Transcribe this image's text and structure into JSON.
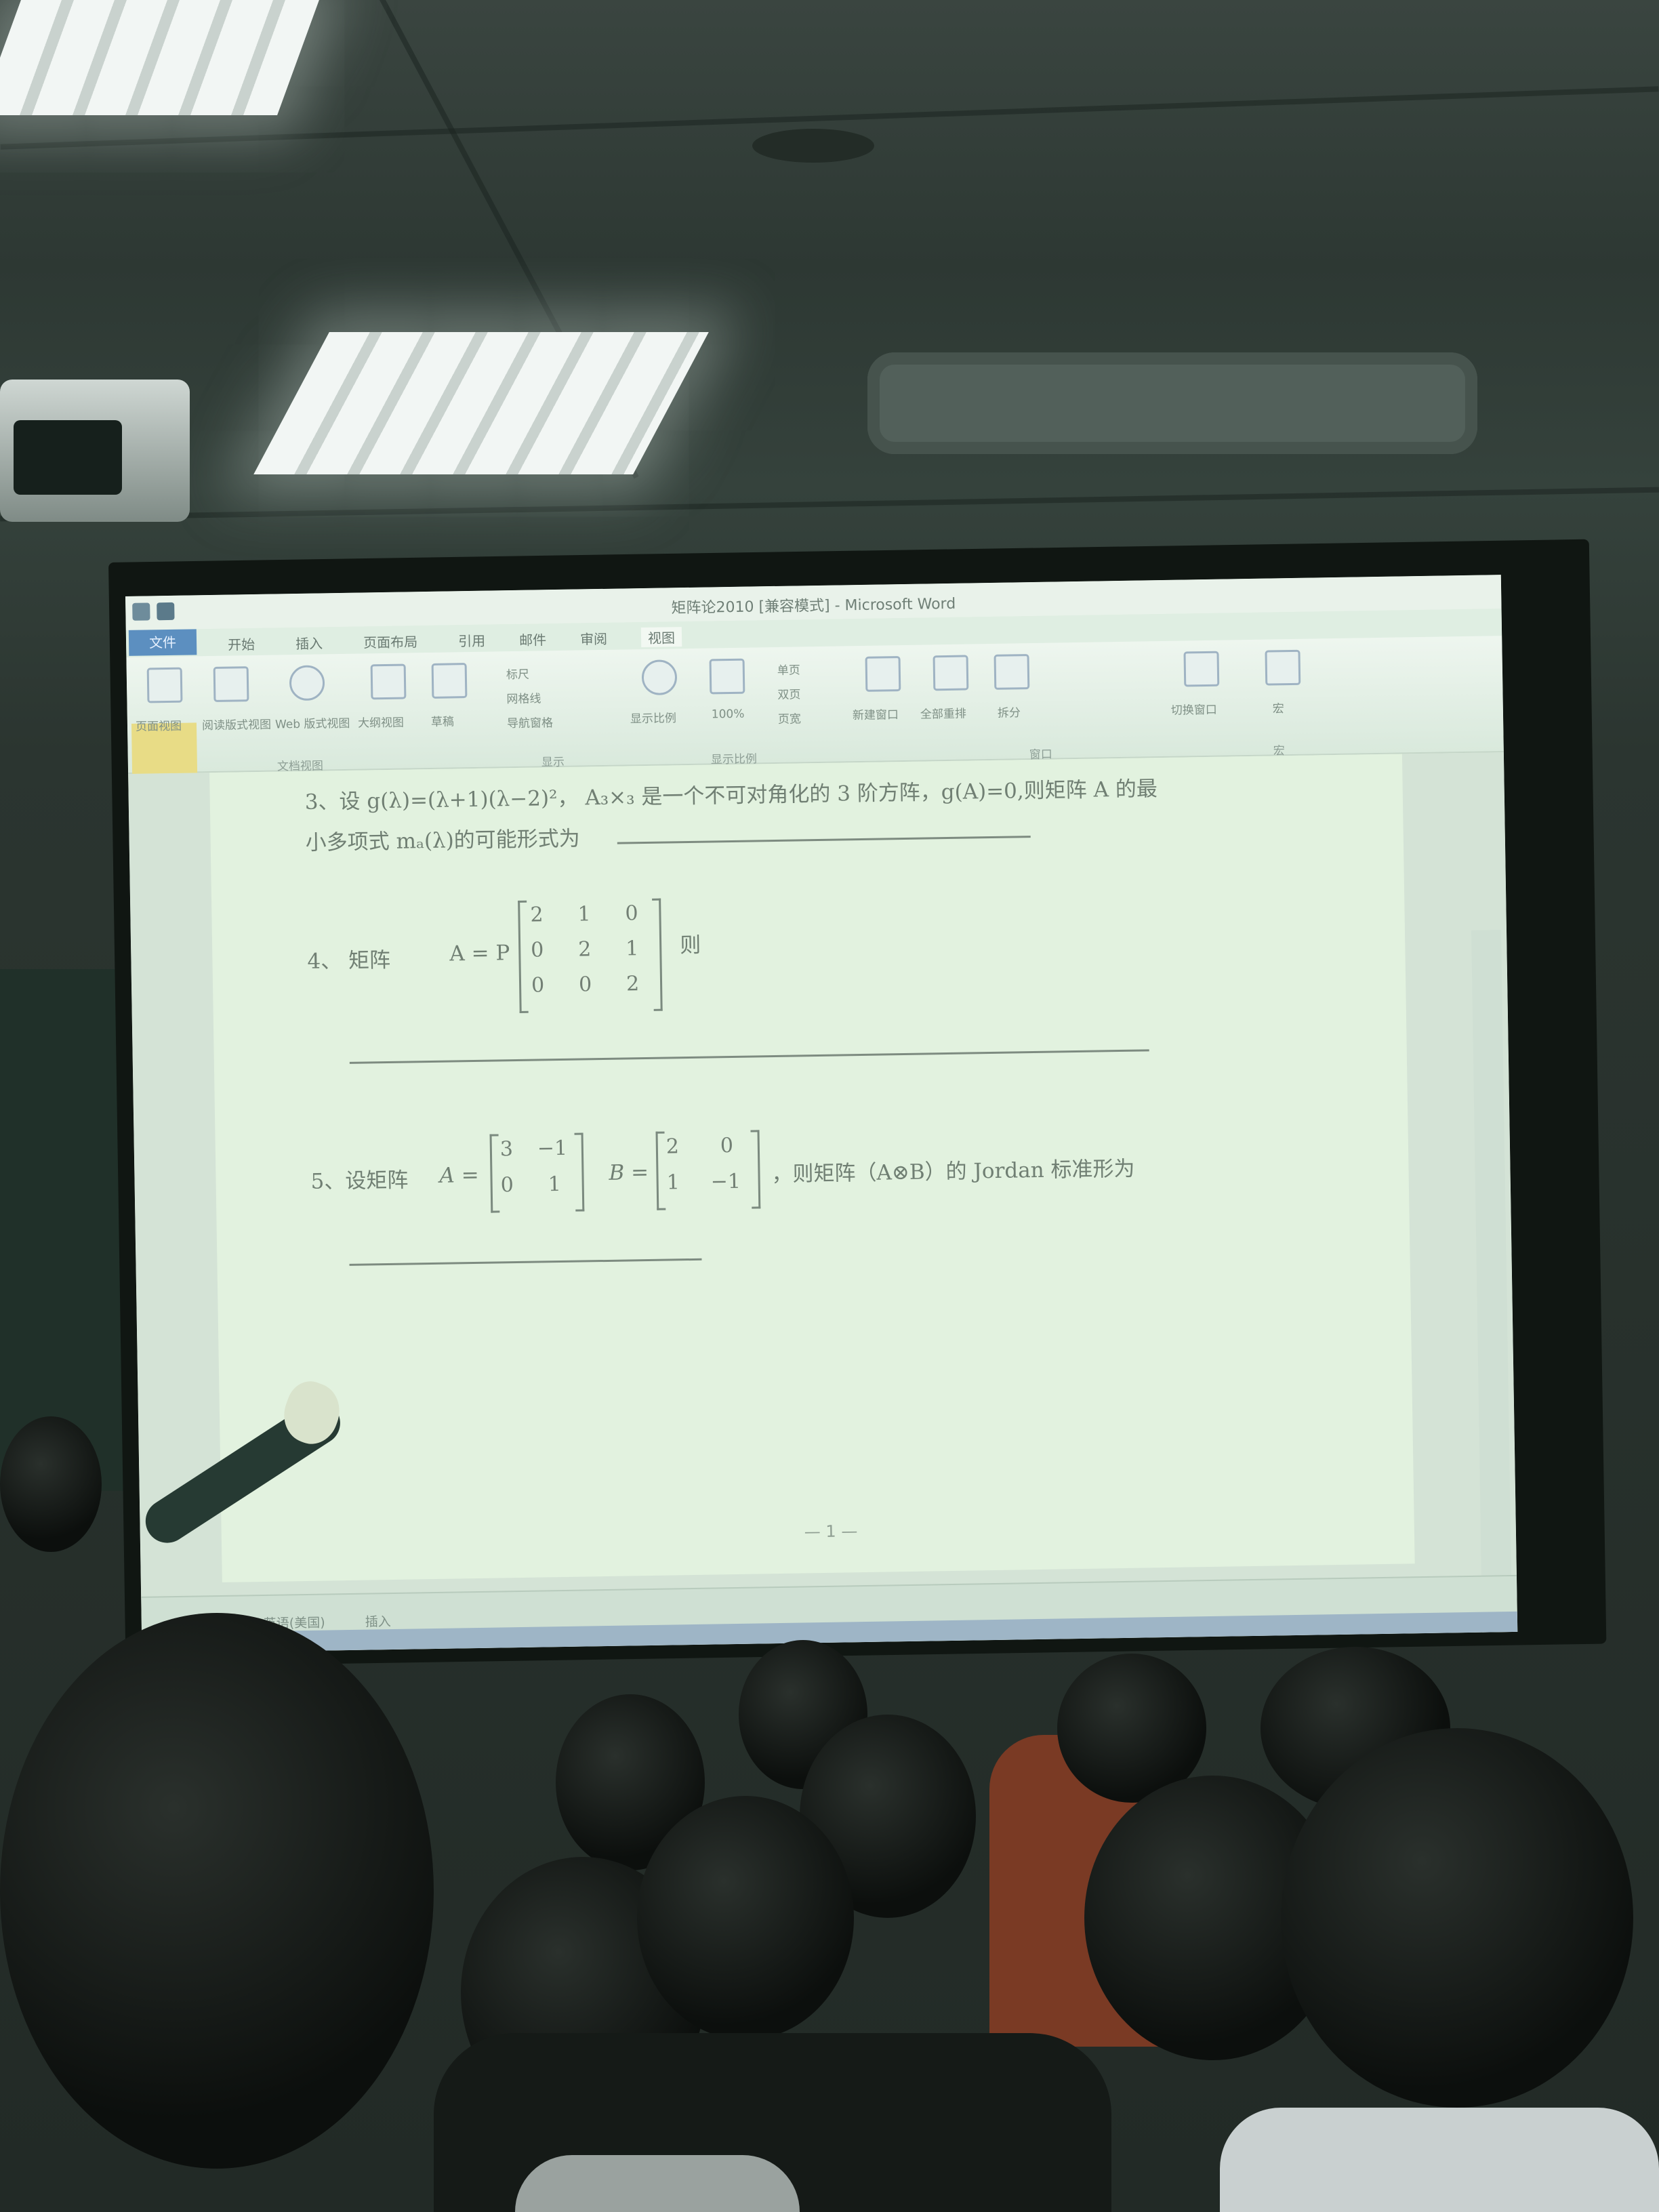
{
  "window": {
    "title": "矩阵论2010 [兼容模式] - Microsoft Word"
  },
  "ribbon": {
    "file_tab": "文件",
    "tabs": [
      "开始",
      "插入",
      "页面布局",
      "引用",
      "邮件",
      "审阅",
      "视图"
    ],
    "buttons": [
      "页面视图",
      "阅读版式视图",
      "Web 版式视图",
      "大纲视图",
      "草稿",
      "标尺",
      "网格线",
      "导航窗格",
      "显示比例",
      "100%",
      "单页",
      "双页",
      "页宽",
      "新建窗口",
      "全部重排",
      "拆分",
      "切换窗口",
      "宏"
    ],
    "groups": [
      "文档视图",
      "显示",
      "显示比例",
      "窗口",
      "宏"
    ]
  },
  "document": {
    "q3_line1": "3、设 g(λ)=(λ+1)(λ−2)²， A₃×₃ 是一个不可对角化的 3 阶方阵，g(A)=0,则矩阵 A 的最",
    "q3_line2": "小多项式 mₐ(λ)的可能形式为",
    "q4_prefix": "4、 矩阵",
    "q4_lhs": "A = P",
    "q4_matrix": [
      [
        "2",
        "1",
        "0"
      ],
      [
        "0",
        "2",
        "1"
      ],
      [
        "0",
        "0",
        "2"
      ]
    ],
    "q4_suffix": "则",
    "q5_prefix": "5、设矩阵",
    "q5_A_label": "A =",
    "q5_A": [
      [
        "3",
        "−1"
      ],
      [
        "0",
        "1"
      ]
    ],
    "q5_B_label": "B =",
    "q5_B": [
      [
        "2",
        "0"
      ],
      [
        "1",
        "−1"
      ]
    ],
    "q5_suffix": "，则矩阵（A⊗B）的 Jordan 标准形为",
    "page_number": "— 1 —"
  },
  "statusbar": {
    "items": [
      "英语(美国)",
      "插入"
    ]
  }
}
